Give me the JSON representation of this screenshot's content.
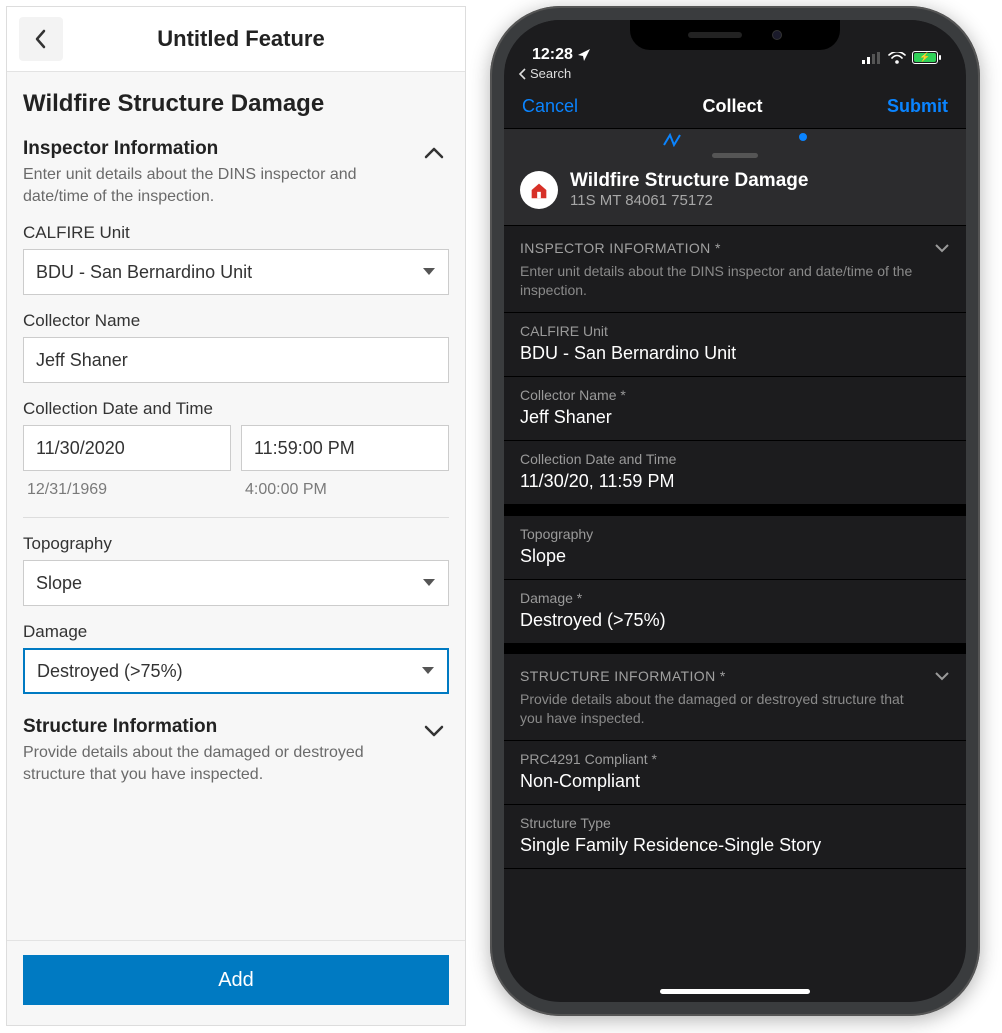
{
  "left": {
    "header_title": "Untitled Feature",
    "form_title": "Wildfire Structure Damage",
    "inspector_section": {
      "title": "Inspector Information",
      "desc": "Enter unit details about the DINS inspector and date/time of the inspection."
    },
    "calfire_unit": {
      "label": "CALFIRE Unit",
      "value": "BDU - San Bernardino Unit"
    },
    "collector_name": {
      "label": "Collector Name",
      "value": "Jeff Shaner"
    },
    "collection_dt": {
      "label": "Collection Date and Time",
      "date": "11/30/2020",
      "time": "11:59:00 PM",
      "meta_date": "12/31/1969",
      "meta_time": "4:00:00 PM"
    },
    "topography": {
      "label": "Topography",
      "value": "Slope"
    },
    "damage": {
      "label": "Damage",
      "value": "Destroyed (>75%)"
    },
    "structure_section": {
      "title": "Structure Information",
      "desc": "Provide details about the damaged or destroyed structure that you have inspected."
    },
    "add_label": "Add"
  },
  "right": {
    "status": {
      "time": "12:28",
      "back_search": "Search"
    },
    "nav": {
      "cancel": "Cancel",
      "title": "Collect",
      "submit": "Submit"
    },
    "peek": {
      "title": "Wildfire Structure Damage",
      "sub": "11S MT 84061 75172"
    },
    "inspector_section": {
      "title": "INSPECTOR INFORMATION *",
      "desc": "Enter unit details about the DINS inspector and date/time of the inspection."
    },
    "calfire_unit": {
      "label": "CALFIRE Unit",
      "value": "BDU - San Bernardino Unit"
    },
    "collector_name": {
      "label": "Collector Name *",
      "value": "Jeff Shaner"
    },
    "collection_dt": {
      "label": "Collection Date and Time",
      "value": "11/30/20, 11:59 PM"
    },
    "topography": {
      "label": "Topography",
      "value": "Slope"
    },
    "damage": {
      "label": "Damage *",
      "value": "Destroyed (>75%)"
    },
    "structure_section": {
      "title": "STRUCTURE INFORMATION *",
      "desc": "Provide details about the damaged or destroyed structure that you have inspected."
    },
    "prc": {
      "label": "PRC4291 Compliant *",
      "value": "Non-Compliant"
    },
    "structure_type": {
      "label": "Structure Type",
      "value": "Single Family Residence-Single Story"
    }
  }
}
